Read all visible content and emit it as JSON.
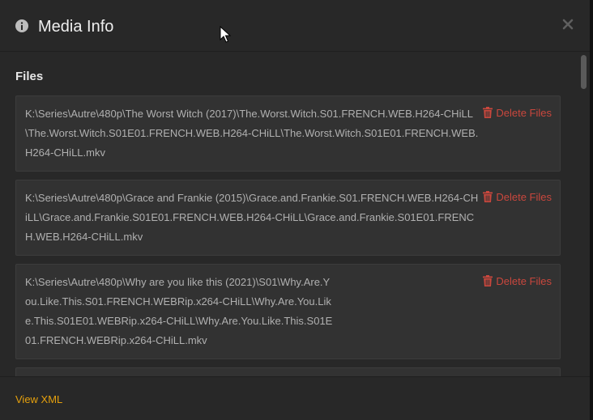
{
  "modal": {
    "title": "Media Info",
    "info_icon": "info-circle-icon",
    "close_icon": "close-icon"
  },
  "files": {
    "section_title": "Files",
    "items": [
      {
        "path": "K:\\Series\\Autre\\480p\\The Worst Witch (2017)\\The.Worst.Witch.S01.FRENCH.WEB.H264-CHiLL\\The.Worst.Witch.S01E01.FRENCH.WEB.H264-CHiLL\\The.Worst.Witch.S01E01.FRENCH.WEB.H264-CHiLL.mkv",
        "delete_label": "Delete Files"
      },
      {
        "path": "K:\\Series\\Autre\\480p\\Grace and Frankie (2015)\\Grace.and.Frankie.S01.FRENCH.WEB.H264-CHiLL\\Grace.and.Frankie.S01E01.FRENCH.WEB.H264-CHiLL\\Grace.and.Frankie.S01E01.FRENCH.WEB.H264-CHiLL.mkv",
        "delete_label": "Delete Files"
      },
      {
        "path": "K:\\Series\\Autre\\480p\\Why are you like this (2021)\\S01\\Why.Are.You.Like.This.S01.FRENCH.WEBRip.x264-CHiLL\\Why.Are.You.Like.This.S01E01.WEBRip.x264-CHiLL\\Why.Are.You.Like.This.S01E01.FRENCH.WEBRip.x264-CHiLL.mkv",
        "delete_label": "Delete Files"
      }
    ]
  },
  "footer": {
    "view_xml_label": "View XML"
  },
  "colors": {
    "accent": "#e5a00d",
    "danger": "#c9473d",
    "background": "#282828",
    "card": "#323232"
  }
}
